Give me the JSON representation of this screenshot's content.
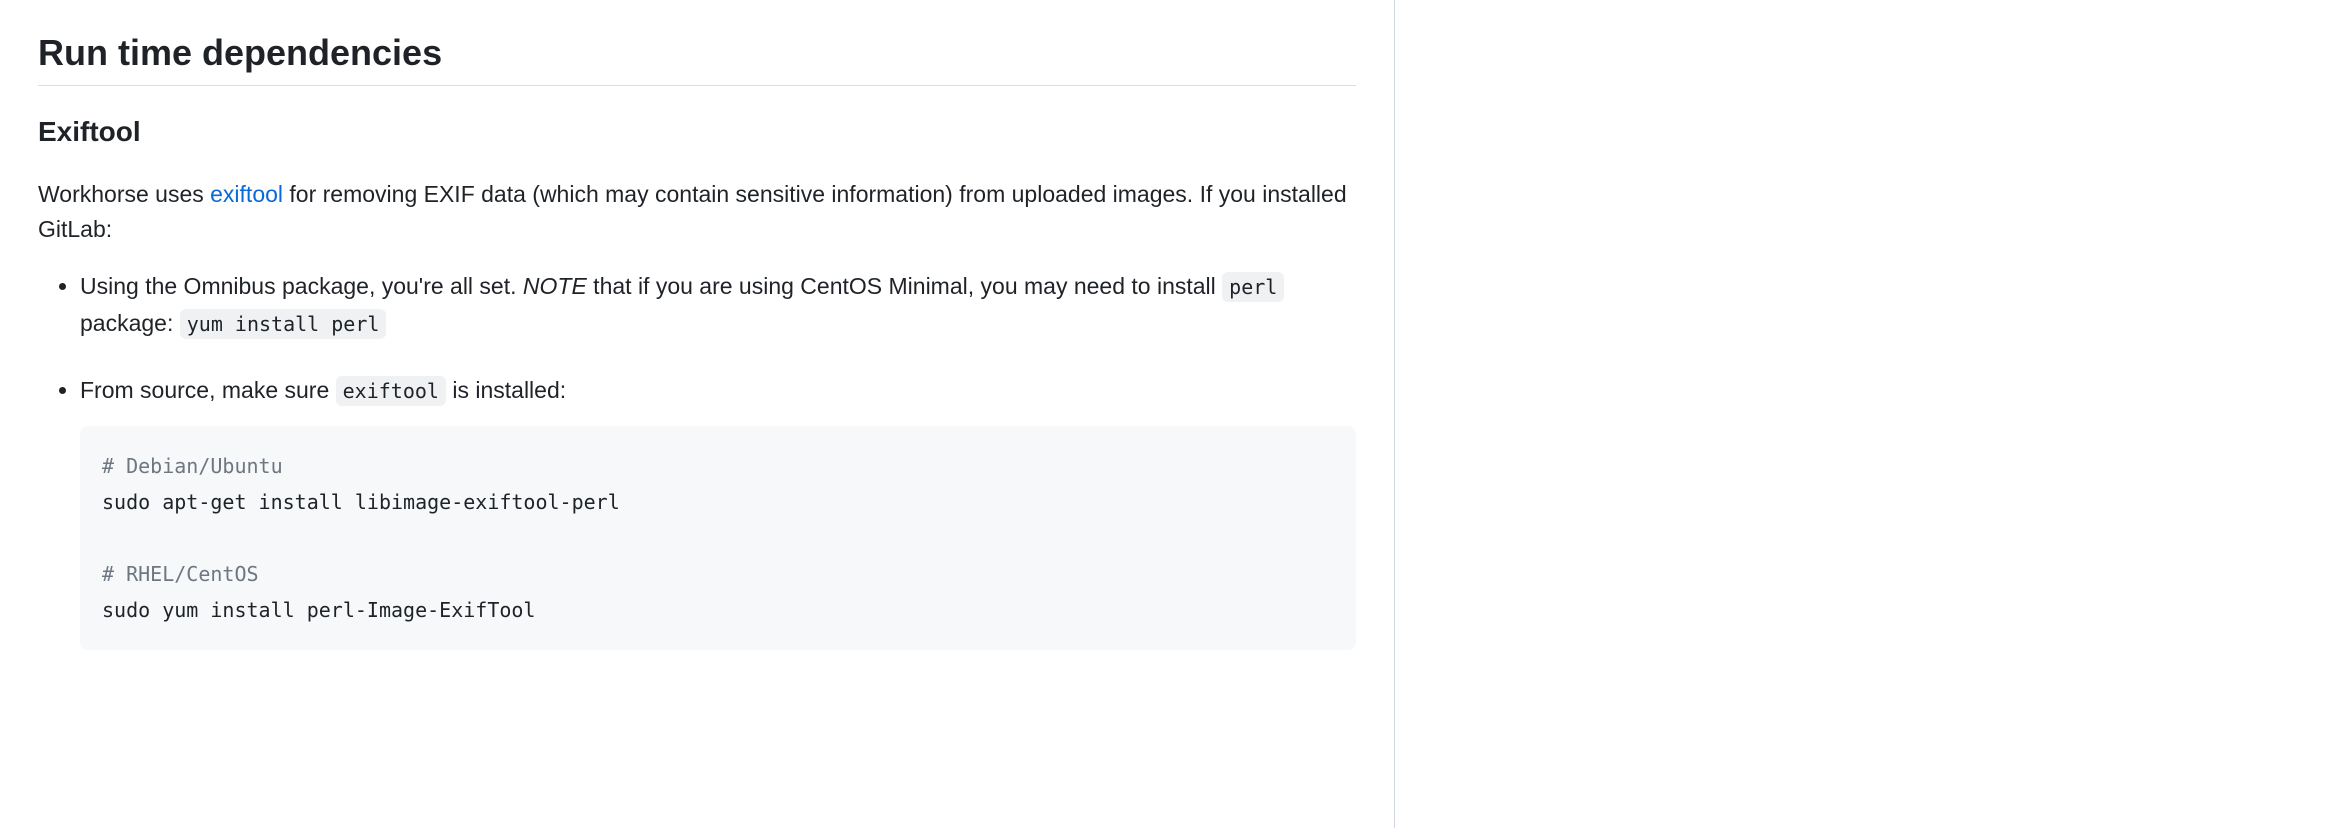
{
  "heading": "Run time dependencies",
  "subheading": "Exiftool",
  "intro": {
    "pre_link": "Workhorse uses ",
    "link_text": "exiftool",
    "post_link": " for removing EXIF data (which may contain sensitive information) from uploaded images. If you installed GitLab:"
  },
  "bullets": [
    {
      "pre1": "Using the Omnibus package, you're all set. ",
      "note": "NOTE",
      "mid1": " that if you are using CentOS Minimal, you may need to install ",
      "code1": "perl",
      "mid2": " package: ",
      "code2": "yum install perl"
    },
    {
      "pre1": "From source, make sure ",
      "code1": "exiftool",
      "post1": " is installed:"
    }
  ],
  "codeblock": {
    "comment1": "# Debian/Ubuntu",
    "line1": "sudo apt-get install libimage-exiftool-perl",
    "comment2": "# RHEL/CentOS",
    "line2": "sudo yum install perl-Image-ExifTool"
  }
}
